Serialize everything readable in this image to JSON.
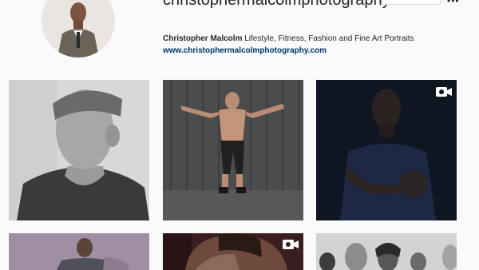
{
  "profile": {
    "username": "christophermalcolmphotography",
    "name": "Christopher Malcolm",
    "bio": "Lifestyle, Fitness, Fashion and Fine Art Portraits",
    "website": "www.christophermalcolmphotography.com"
  },
  "header_actions": {
    "more_icon": "ellipsis-icon",
    "more_glyph": "•••"
  },
  "grid": {
    "rows": 2,
    "columns": 3,
    "posts": [
      {
        "type": "photo",
        "subject": "man in headband profile"
      },
      {
        "type": "photo",
        "subject": "shirtless man jumping"
      },
      {
        "type": "video",
        "subject": "man holding football",
        "icon": "video-camera-icon"
      },
      {
        "type": "photo",
        "subject": "seated man"
      },
      {
        "type": "video",
        "subject": "couple embracing",
        "icon": "video-camera-icon"
      },
      {
        "type": "photo",
        "subject": "group portrait"
      }
    ]
  },
  "colors": {
    "background": "#fafafa",
    "link": "#003569",
    "text": "#262626"
  }
}
